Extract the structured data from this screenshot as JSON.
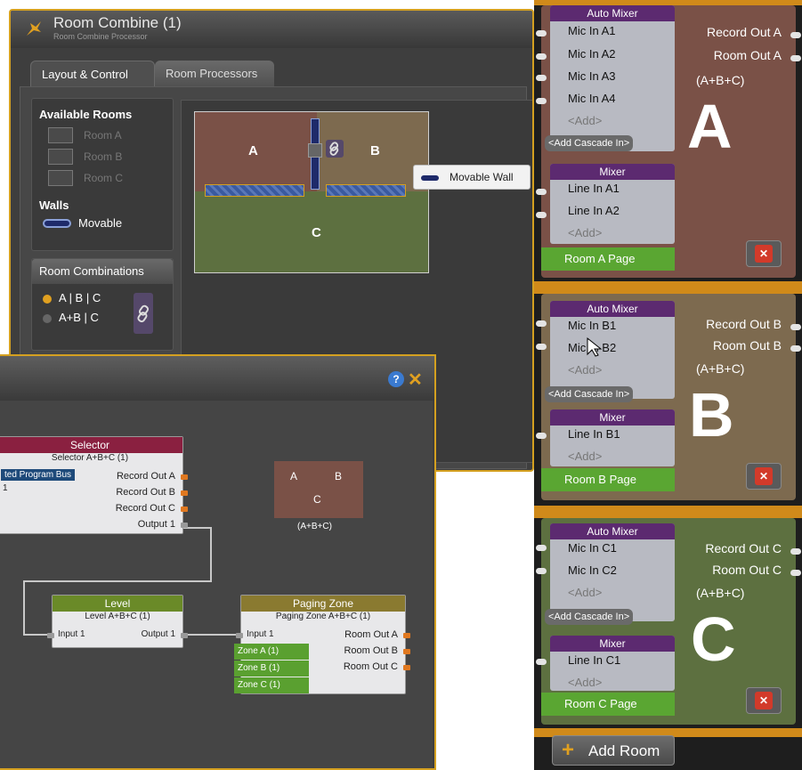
{
  "win1": {
    "title": "Room Combine (1)",
    "subtitle": "Room Combine Processor",
    "tabs": [
      "Layout & Control",
      "Room Processors"
    ],
    "available_rooms": {
      "header": "Available Rooms",
      "items": [
        "Room A",
        "Room B",
        "Room C"
      ]
    },
    "walls": {
      "header": "Walls",
      "movable": "Movable"
    },
    "combinations": {
      "header": "Room Combinations",
      "options": [
        "A | B | C",
        "A+B | C"
      ],
      "selected_index": 0
    },
    "canvas": {
      "label_a": "A",
      "label_b": "B",
      "label_c": "C",
      "tooltip": "Movable Wall"
    }
  },
  "win2": {
    "selector": {
      "title": "Selector",
      "subtitle": "Selector A+B+C (1)",
      "tag": "ted Program Bus",
      "input": "1",
      "outputs": [
        "Record Out A",
        "Record Out B",
        "Record Out C",
        "Output 1"
      ]
    },
    "room_tile": {
      "a": "A",
      "b": "B",
      "c": "C",
      "caption": "(A+B+C)"
    },
    "level": {
      "title": "Level",
      "subtitle": "Level A+B+C (1)",
      "input": "Input 1",
      "output": "Output 1"
    },
    "paging": {
      "title": "Paging Zone",
      "subtitle": "Paging Zone A+B+C (1)",
      "input": "Input 1",
      "zones": [
        "Zone A (1)",
        "Zone B (1)",
        "Zone C (1)"
      ],
      "outputs": [
        "Room Out A",
        "Room Out B",
        "Room Out C"
      ]
    }
  },
  "right": {
    "rooms": [
      {
        "letter": "A",
        "auto_mixer": "Auto Mixer",
        "mics": [
          "Mic In A1",
          "Mic In A2",
          "Mic In A3",
          "Mic In A4"
        ],
        "add": "<Add>",
        "cascade": "<Add Cascade In>",
        "mixer": "Mixer",
        "lines": [
          "Line In A1",
          "Line In A2"
        ],
        "page": "Room A Page",
        "record": "Record Out A",
        "room_out": "Room Out A",
        "combo": "(A+B+C)"
      },
      {
        "letter": "B",
        "auto_mixer": "Auto Mixer",
        "mics": [
          "Mic In B1",
          "Mic In B2"
        ],
        "add": "<Add>",
        "cascade": "<Add Cascade In>",
        "mixer": "Mixer",
        "lines": [
          "Line In B1"
        ],
        "page": "Room B Page",
        "record": "Record Out B",
        "room_out": "Room Out B",
        "combo": "(A+B+C)"
      },
      {
        "letter": "C",
        "auto_mixer": "Auto Mixer",
        "mics": [
          "Mic In C1",
          "Mic In C2"
        ],
        "add": "<Add>",
        "cascade": "<Add Cascade In>",
        "mixer": "Mixer",
        "lines": [
          "Line In C1"
        ],
        "page": "Room C Page",
        "record": "Record Out C",
        "room_out": "Room Out C",
        "combo": "(A+B+C)"
      }
    ],
    "add_room": "Add Room",
    "colors": {
      "room_a": "#7a5147",
      "room_b": "#7d6a4f",
      "room_c": "#5d7040",
      "accent": "#d4a020",
      "page_green": "#5aa632",
      "mixer_purple": "#5c2a70"
    }
  }
}
